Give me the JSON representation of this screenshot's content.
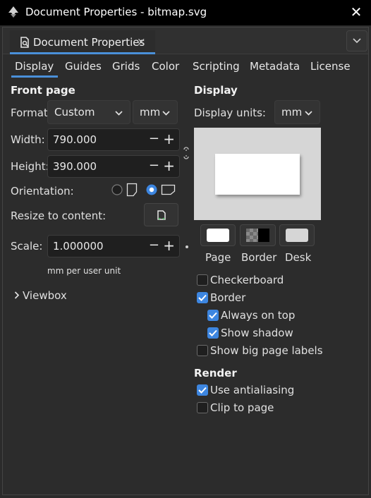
{
  "window": {
    "title": "Document Properties - bitmap.svg"
  },
  "dock_tab": {
    "label": "Document Properties",
    "close": "×"
  },
  "tabs": [
    "Display",
    "Guides",
    "Grids",
    "Color",
    "Scripting",
    "Metadata",
    "License"
  ],
  "front_page": {
    "heading": "Front page",
    "format_label": "Format:",
    "format_value": "Custom",
    "unit_value": "mm",
    "width_label": "Width:",
    "width_value": "790.000",
    "height_label": "Height:",
    "height_value": "390.000",
    "orientation_label": "Orientation:",
    "resize_label": "Resize to content:",
    "scale_label": "Scale:",
    "scale_value": "1.000000",
    "scale_unit_note": "mm per user unit",
    "viewbox_label": "Viewbox"
  },
  "display": {
    "heading": "Display",
    "display_units_label": "Display units:",
    "display_units_value": "mm",
    "page_label": "Page",
    "border_label": "Border",
    "desk_label": "Desk",
    "checkboxes": {
      "checkerboard": {
        "label": "Checkerboard",
        "checked": false
      },
      "border": {
        "label": "Border",
        "checked": true
      },
      "always_on_top": {
        "label": "Always on top",
        "checked": true
      },
      "show_shadow": {
        "label": "Show shadow",
        "checked": true
      },
      "show_big_page_labels": {
        "label": "Show big page labels",
        "checked": false
      }
    }
  },
  "render": {
    "heading": "Render",
    "use_antialiasing": {
      "label": "Use antialiasing",
      "checked": true
    },
    "clip_to_page": {
      "label": "Clip to page",
      "checked": false
    }
  },
  "colors": {
    "accent": "#3d86e0",
    "titlebar": "#000000",
    "background": "#2c2c2c"
  }
}
